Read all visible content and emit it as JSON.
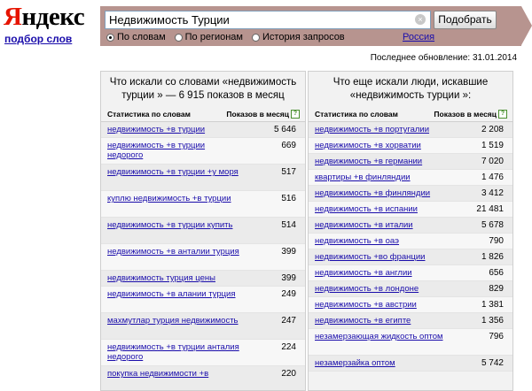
{
  "logo": {
    "first_letter": "Я",
    "rest": "ндекс",
    "subtitle": "подбор слов"
  },
  "search": {
    "value": "Недвижимость Турции",
    "clear_icon": "×",
    "button": "Подобрать",
    "modes": [
      {
        "label": "По словам",
        "selected": true
      },
      {
        "label": "По регионам",
        "selected": false
      },
      {
        "label": "История запросов",
        "selected": false
      }
    ],
    "region": "Россия"
  },
  "updated": "Последнее обновление: 31.01.2014",
  "left_panel": {
    "title": "Что искали со словами «недвижимость турции » — 6 915 показов в месяц",
    "col_phrase": "Статистика по словам",
    "col_count": "Показов в месяц",
    "help": "?",
    "rows": [
      {
        "phrase": "недвижимость +в турции",
        "count": "5 646",
        "lines": 1
      },
      {
        "phrase": "недвижимость +в турции недорого",
        "count": "669",
        "lines": 2
      },
      {
        "phrase": "недвижимость +в турции +у моря",
        "count": "517",
        "lines": 2
      },
      {
        "phrase": "куплю недвижимость +в турции",
        "count": "516",
        "lines": 2
      },
      {
        "phrase": "недвижимость +в турции купить",
        "count": "514",
        "lines": 2
      },
      {
        "phrase": "недвижимость +в анталии турция",
        "count": "399",
        "lines": 2
      },
      {
        "phrase": "недвижимость турция цены",
        "count": "399",
        "lines": 1
      },
      {
        "phrase": "недвижимость +в алании турция",
        "count": "249",
        "lines": 2
      },
      {
        "phrase": "махмутлар турция недвижимость",
        "count": "247",
        "lines": 2
      },
      {
        "phrase": "недвижимость +в турции анталия недорого",
        "count": "224",
        "lines": 2
      },
      {
        "phrase": "покупка недвижимости +в",
        "count": "220",
        "lines": 2
      }
    ]
  },
  "right_panel": {
    "title": "Что еще искали люди, искавшие «недвижимость турции »:",
    "col_phrase": "Статистика по словам",
    "col_count": "Показов в месяц",
    "help": "?",
    "rows": [
      {
        "phrase": "недвижимость +в португалии",
        "count": "2 208",
        "lines": 1
      },
      {
        "phrase": "недвижимость +в хорватии",
        "count": "1 519",
        "lines": 1
      },
      {
        "phrase": "недвижимость +в германии",
        "count": "7 020",
        "lines": 1
      },
      {
        "phrase": "квартиры +в финляндии",
        "count": "1 476",
        "lines": 1
      },
      {
        "phrase": "недвижимость +в финляндии",
        "count": "3 412",
        "lines": 1
      },
      {
        "phrase": "недвижимость +в испании",
        "count": "21 481",
        "lines": 1
      },
      {
        "phrase": "недвижимость +в италии",
        "count": "5 678",
        "lines": 1
      },
      {
        "phrase": "недвижимость +в оаэ",
        "count": "790",
        "lines": 1
      },
      {
        "phrase": "недвижимость +во франции",
        "count": "1 826",
        "lines": 1
      },
      {
        "phrase": "недвижимость +в англии",
        "count": "656",
        "lines": 1
      },
      {
        "phrase": "недвижимость +в лондоне",
        "count": "829",
        "lines": 1
      },
      {
        "phrase": "недвижимость +в австрии",
        "count": "1 381",
        "lines": 1
      },
      {
        "phrase": "недвижимость +в египте",
        "count": "1 356",
        "lines": 1
      },
      {
        "phrase": "незамерзающая жидкость оптом",
        "count": "796",
        "lines": 2
      },
      {
        "phrase": "незамерзайка оптом",
        "count": "5 742",
        "lines": 1
      }
    ]
  }
}
